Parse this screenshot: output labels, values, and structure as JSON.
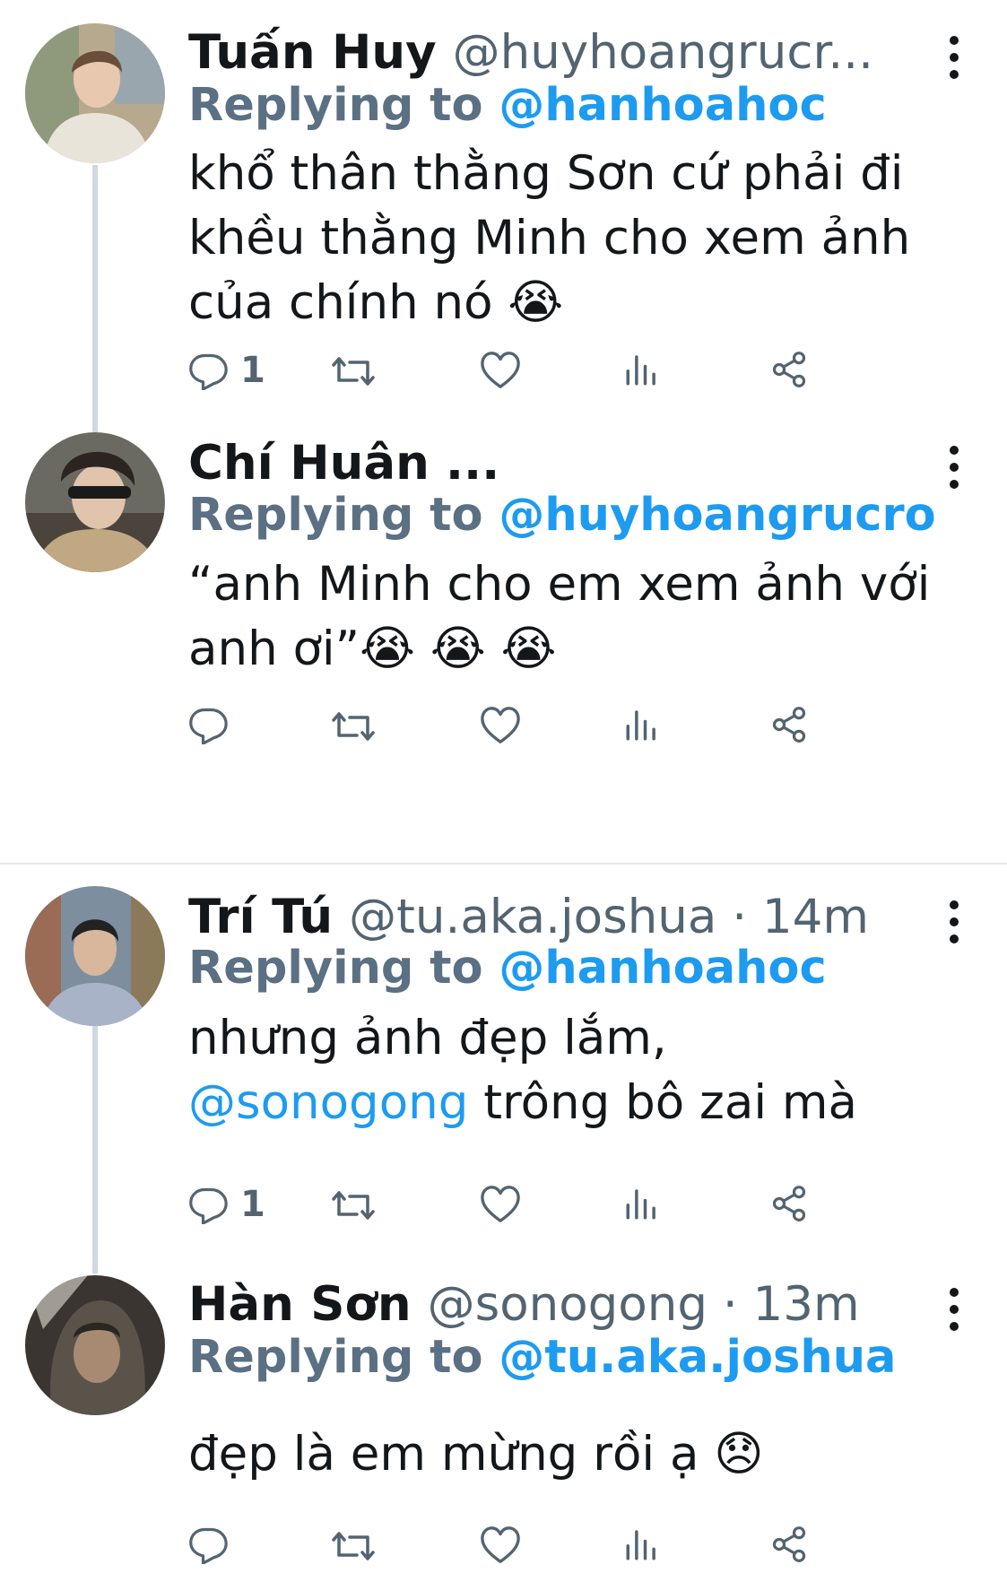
{
  "replies": [
    {
      "name": "Tuấn Huy",
      "handle": "@huyhoangrucr...",
      "replying_label": "Replying to",
      "replying_to": "@hanhoahoc",
      "text_lines": [
        "khổ thân thằng Sơn cứ phải đi",
        "khều thằng Minh cho xem ảnh",
        "của chính nó 😭"
      ],
      "reply_count": "1"
    },
    {
      "name": "Chí Huân",
      "handle": "...",
      "replying_label": "Replying to",
      "replying_to": "@huyhoangrucro",
      "text_lines": [
        "“anh Minh cho em xem ảnh với",
        "anh ơi”😭 😭 😭"
      ],
      "reply_count": ""
    },
    {
      "name": "Trí Tú",
      "handle": "@tu.aka.joshua · 14m",
      "replying_label": "Replying to",
      "replying_to": "@hanhoahoc",
      "text_line1": "nhưng ảnh đẹp lắm,",
      "text_mention": "@sonogong",
      "text_line2_rest": " trông bô zai mà",
      "reply_count": "1"
    },
    {
      "name": "Hàn Sơn",
      "handle": "@sonogong · 13m",
      "replying_label": "Replying to",
      "replying_to": "@tu.aka.joshua",
      "text_lines": [
        "đẹp là em mừng rồi ạ 😞"
      ],
      "reply_count": ""
    }
  ],
  "icons": {
    "reply": "reply-icon",
    "retweet": "retweet-icon",
    "like": "heart-icon",
    "views": "analytics-icon",
    "share": "share-icon",
    "more": "more-dots-icon"
  },
  "colors": {
    "link": "#1d9bf0",
    "secondary": "#536471",
    "icon": "#536471",
    "thread_line": "#cfd9de"
  }
}
